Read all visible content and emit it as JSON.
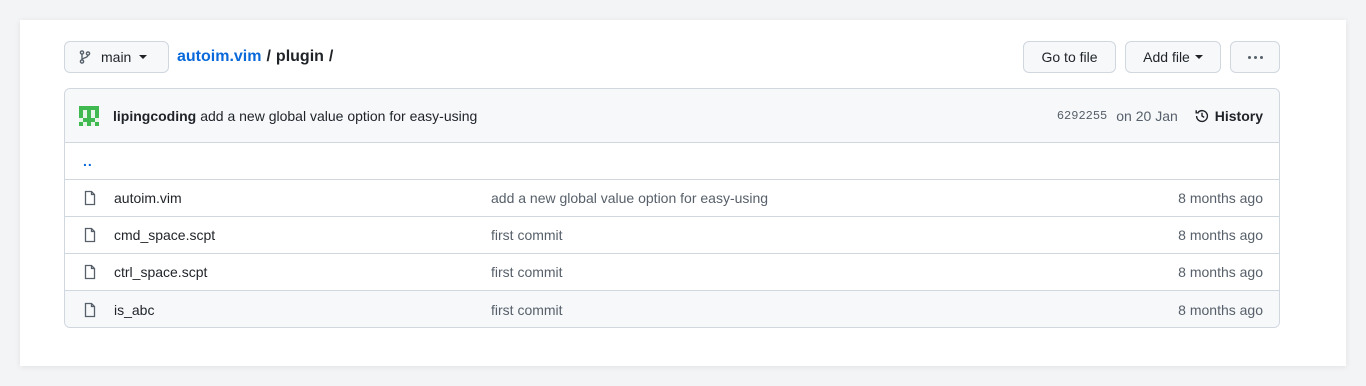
{
  "branch": {
    "name": "main"
  },
  "breadcrumb": {
    "repo": "autoim.vim",
    "sep1": "/",
    "folder": "plugin",
    "sep2": "/"
  },
  "actions": {
    "go_to_file": "Go to file",
    "add_file": "Add file"
  },
  "latest_commit": {
    "author": "lipingcoding",
    "message": "add a new global value option for easy-using",
    "sha": "6292255",
    "date": "on 20 Jan",
    "history_label": "History"
  },
  "parent_dir": "..",
  "files": [
    {
      "name": "autoim.vim",
      "message": "add a new global value option for easy-using",
      "age": "8 months ago"
    },
    {
      "name": "cmd_space.scpt",
      "message": "first commit",
      "age": "8 months ago"
    },
    {
      "name": "ctrl_space.scpt",
      "message": "first commit",
      "age": "8 months ago"
    },
    {
      "name": "is_abc",
      "message": "first commit",
      "age": "8 months ago"
    }
  ],
  "colors": {
    "link": "#0969da",
    "avatar": "#3fb950",
    "border": "#d0d7de"
  }
}
